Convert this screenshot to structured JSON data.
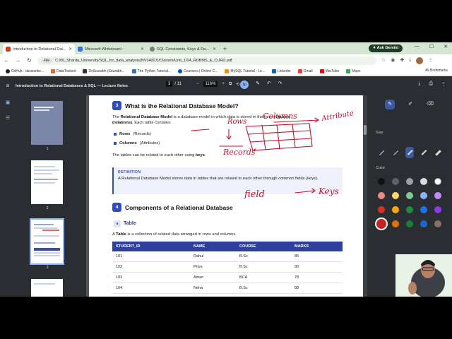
{
  "browser": {
    "tabs": [
      {
        "label": "Introduction to Relational Dat...",
        "color": "#c1442a",
        "active": true
      },
      {
        "label": "Microsoft Whiteboard",
        "color": "#3b6fd8",
        "active": false
      },
      {
        "label": "SQL Constraints, Keys & Data Ty...",
        "color": "#7a7a7a",
        "active": false
      }
    ],
    "gemini_label": "Ask Gemini",
    "address": "C:/00_Sharda_University/SQL_for_data_analysis(NV34007)/Classes/Unit_1/04_RDBMS_&_CURD.pdf",
    "address_prefix": "File",
    "bookmarks": [
      "GitHub - dsscientis...",
      "DataTrained",
      "DsSourabh (Sourabh...",
      "The Python Tutorial...",
      "Coursera | Online C...",
      "MySQL Tutorial - Le...",
      "Linkedin",
      "Gmail",
      "YouTube",
      "Maps"
    ],
    "all_bookmarks": "All Bookmarks"
  },
  "pdf": {
    "title": "Introduction to Relational Databases & SQL — Lecture Notes",
    "page_current": "3",
    "page_total": "/ 11",
    "zoom": "116%",
    "thumbnails": [
      "1",
      "2",
      "3"
    ]
  },
  "content": {
    "sec3_num": "3",
    "sec3_title": "What is the Relational Database Model?",
    "intro_a": "The ",
    "intro_b": "Relational Database Model",
    "intro_c": " is a database model in which data is stored in the form of ",
    "intro_d": "tables",
    "intro_e": "(relations)",
    "intro_f": ". Each table contains:",
    "bullet1_b": "Rows",
    "bullet1_t": "(Records)",
    "bullet2_b": "Columns",
    "bullet2_t": "(Attributes)",
    "related_a": "The tables can be related to each other using ",
    "related_b": "keys",
    "related_c": ".",
    "def_label": "DEFINITION",
    "def_text": "A Relational Database Model stores data in tables that are related to each other through common fields (keys).",
    "sec4_num": "4",
    "sec4_title": "Components of a Relational Database",
    "sub_a": "a",
    "sub_title": "Table",
    "table_desc_a": "A ",
    "table_desc_b": "Table",
    "table_desc_c": " is a collection of related data arranged in rows and columns.",
    "table": {
      "headers": [
        "STUDENT_ID",
        "NAME",
        "COURSE",
        "MARKS"
      ],
      "rows": [
        [
          "101",
          "Rahul",
          "B.Sc",
          "85"
        ],
        [
          "102",
          "Priya",
          "B.Sc",
          "90"
        ],
        [
          "103",
          "Aman",
          "BCA",
          "78"
        ],
        [
          "104",
          "Neha",
          "B.Sc",
          "88"
        ]
      ]
    },
    "ink": {
      "color": "#c0142b",
      "notes": [
        "Rows",
        "Columns",
        "Attribute",
        "Records",
        "field",
        "Keys"
      ]
    }
  },
  "annotation": {
    "size_label": "Size",
    "color_label": "Color",
    "colors": [
      "#111111",
      "#5f6368",
      "#9aa0a6",
      "#dadce0",
      "#ffffff",
      "#f28b82",
      "#fdd663",
      "#81c995",
      "#8ab4f8",
      "#c58af9",
      "#d93025",
      "#f9ab00",
      "#1e8e3e",
      "#1a73e8",
      "#9334e6",
      "#c5221f",
      "#e37400",
      "#188038",
      "#1967d2",
      "#8d6e63"
    ],
    "selected_color": "#c5221f"
  }
}
